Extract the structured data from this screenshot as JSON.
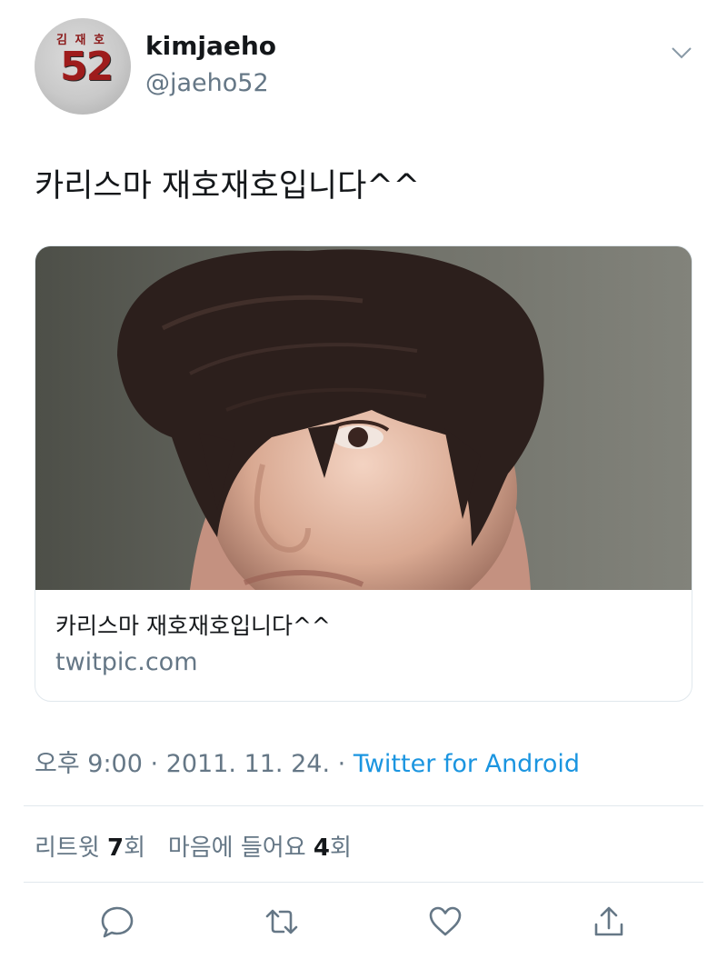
{
  "user": {
    "display_name": "kimjaeho",
    "handle": "@jaeho52",
    "avatar_name_text": "김 재 호",
    "avatar_number": "52"
  },
  "tweet": {
    "text": "카리스마 재호재호입니다^^"
  },
  "card": {
    "title": "카리스마 재호재호입니다^^",
    "domain": "twitpic.com"
  },
  "meta": {
    "time": "오후 9:00",
    "separator": "·",
    "date": "2011. 11. 24.",
    "source": "Twitter for Android"
  },
  "stats": {
    "retweets_label": "리트윗",
    "retweets_count": "7",
    "retweets_unit": "회",
    "likes_label": "마음에 들어요",
    "likes_count": "4",
    "likes_unit": "회"
  },
  "actions": [
    "reply-icon",
    "retweet-icon",
    "like-icon",
    "share-icon",
    "chevron-down-icon"
  ],
  "colors": {
    "text": "#14171a",
    "secondary": "#657786",
    "link": "#1b95e0",
    "border": "#e1e8ed",
    "avatar_number": "#9e1c1c"
  }
}
